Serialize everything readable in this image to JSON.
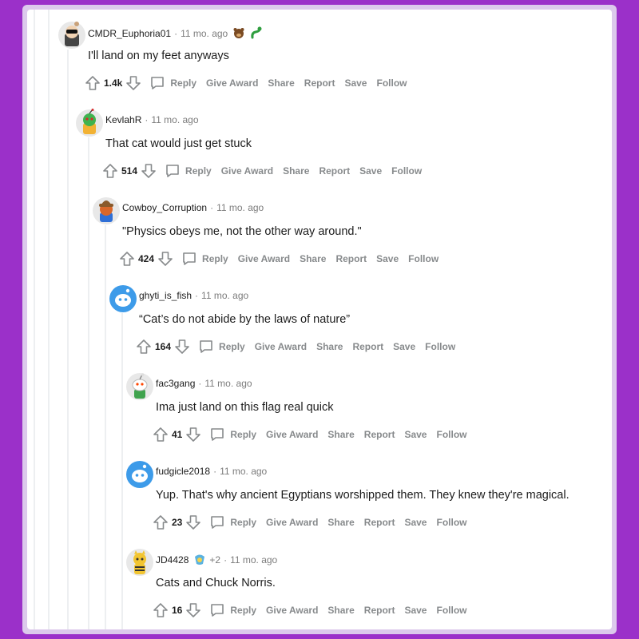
{
  "colors": {
    "background": "#9b30c9",
    "frame": "#dcc9ec",
    "panel": "#ffffff",
    "action_text": "#878a8c"
  },
  "action_labels": {
    "reply": "Reply",
    "give_award": "Give Award",
    "share": "Share",
    "report": "Report",
    "save": "Save",
    "follow": "Follow"
  },
  "comments": [
    {
      "author": "CMDR_Euphoria01",
      "time": "11 mo. ago",
      "text": "I'll land on my feet anyways",
      "score": "1.4k",
      "flair_icons": [
        "bear-emoji-icon",
        "green-snake-icon"
      ]
    },
    {
      "author": "KevlahR",
      "time": "11 mo. ago",
      "text": "That cat would just get stuck",
      "score": "514"
    },
    {
      "author": "Cowboy_Corruption",
      "time": "11 mo. ago",
      "text": "\"Physics obeys me, not the other way around.\"",
      "score": "424"
    },
    {
      "author": "ghyti_is_fish",
      "time": "11 mo. ago",
      "text": "“Cat’s do not abide by the laws of nature”",
      "score": "164"
    },
    {
      "author": "fac3gang",
      "time": "11 mo. ago",
      "text": "Ima just land on this flag real quick",
      "score": "41"
    },
    {
      "author": "fudgicle2018",
      "time": "11 mo. ago",
      "text": "Yup. That's why ancient Egyptians worshipped them. They knew they're magical.",
      "score": "23"
    },
    {
      "author": "JD4428",
      "time": "11 mo. ago",
      "text": "Cats and Chuck Norris.",
      "score": "16",
      "award_extra": "+2",
      "flair_icons": [
        "award-icon"
      ]
    }
  ]
}
